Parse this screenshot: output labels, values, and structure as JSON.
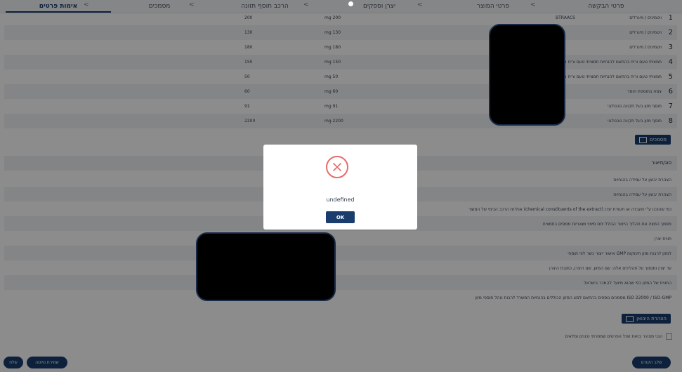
{
  "tabs": [
    {
      "label": "פרטי הבקשה"
    },
    {
      "label": "פרטי המוצר"
    },
    {
      "label": "יצרן וספקים"
    },
    {
      "label": "הרכב תוסף תזונה"
    },
    {
      "label": "מסמכים"
    },
    {
      "label": "אימות פרטים"
    }
  ],
  "chevron": "<",
  "ingredients": [
    {
      "num": "1",
      "name": "ויטמינים / מינרלים",
      "code": "BTRAACS",
      "unit": "mg 200",
      "value": "200"
    },
    {
      "num": "2",
      "name": "ויטמינים / מינרלים",
      "unit": "mg 130",
      "value": "130"
    },
    {
      "num": "3",
      "name": "ויטמינים / מינרלים",
      "unit": "mg 180",
      "value": "180"
    },
    {
      "num": "4",
      "name": "תמציתי טעם וריח בהתאם להנחיות תמציתי טעם וריח המשרד\"ה",
      "unit": "mg 150",
      "value": "150"
    },
    {
      "num": "5",
      "name": "תמציתי טעם וריח בהתאם להנחיות תמציתי טעם וריח המשרד\"ה",
      "unit": "mg 50",
      "value": "50"
    },
    {
      "num": "6",
      "name": "צמח בתוספת חומר",
      "unit": "mg 60",
      "value": "60"
    },
    {
      "num": "7",
      "name": "תוסף מזון בעל תקינה טכנולוגי",
      "unit": "mg 91",
      "value": "91"
    },
    {
      "num": "8",
      "name": "תוסף מזון בעל תקינה טכנולוגי",
      "unit": "mg 2200",
      "value": "2200"
    }
  ],
  "documents_section": {
    "label": "מסמכים"
  },
  "documents_header": "סוג/תיאור",
  "documents": [
    "הצהרת יבואן על עמידה בהנחיות",
    "הצהרת יבואן על עמידה בהנחיות",
    "אנליזת הרכב הכימי של המוצר (chemical constituents of the extract) כפי שהוכנו ע\"י מעבדה או תעודת יצרן",
    "מסמך המציג את תהליך הייצור הכולל יחס מיצוי ושאריות ממסים בתמצית",
    "תווית יצרן",
    "אישור ייצור כשר לפי תוספי GMP למזון לרבות מזון תינוקות",
    "עד יצרן ומסמך על תהליכים אלה: שם המזון, שם היצרן, כתובת היצרן",
    "התווית של המזון כפי שהוא מיועד להמכר בישראל",
    "מסמכים נוספים בהתאם לסוג המזון הכוללים בהנחיות המשרד לרבות נוהל תוספי מזון ISO 22000 / ISO-GMP"
  ],
  "declaration_section": {
    "label": "הצהרת היבואן"
  },
  "declaration_text": "הנני מצהיר בזאת שכל הפרטים שמסרתי נכונים ומלאים",
  "modal": {
    "message": "undefined",
    "ok_label": "OK"
  },
  "bottom": {
    "prev_label": "שלב הקודם",
    "save_label": "שמירת טיוטה",
    "submit_label": "שלח"
  },
  "colors": {
    "primary": "#1a3d6d",
    "error": "#e86b6b",
    "overlay": "rgba(0,0,0,0.45)"
  }
}
